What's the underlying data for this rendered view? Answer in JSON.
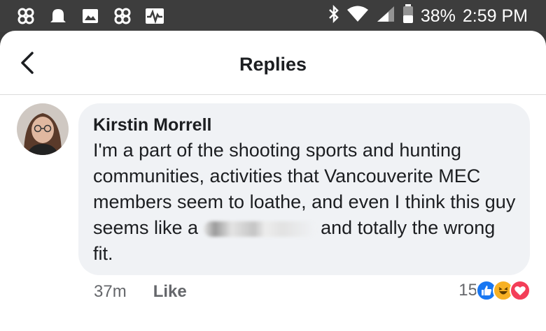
{
  "status_bar": {
    "battery": "38%",
    "time": "2:59 PM",
    "icons": [
      "pinwheel-icon",
      "bell-icon",
      "image-icon",
      "pinwheel-icon",
      "activity-icon",
      "bluetooth-icon",
      "wifi-icon",
      "signal-icon",
      "battery-icon"
    ]
  },
  "header": {
    "title": "Replies",
    "back_icon": "chevron-left-icon"
  },
  "comment": {
    "author": "Kirstin Morrell",
    "text_before": "I'm a part of the shooting sports and hunting communities, activities that Vancouverite MEC members seem to loathe, and even I think this guy seems like a",
    "text_after": "and totally the wrong fit.",
    "time": "37m",
    "like_label": "Like",
    "reaction_count": "15",
    "reactions": [
      "like-reaction-icon",
      "haha-reaction-icon",
      "love-reaction-icon"
    ],
    "colors": {
      "like": "#1877f2",
      "haha": "#f7b125",
      "love": "#f33e58"
    }
  },
  "colors": {
    "status_bar": "#3d3d3d",
    "bubble": "#f0f2f5",
    "meta_text": "#65676b"
  }
}
